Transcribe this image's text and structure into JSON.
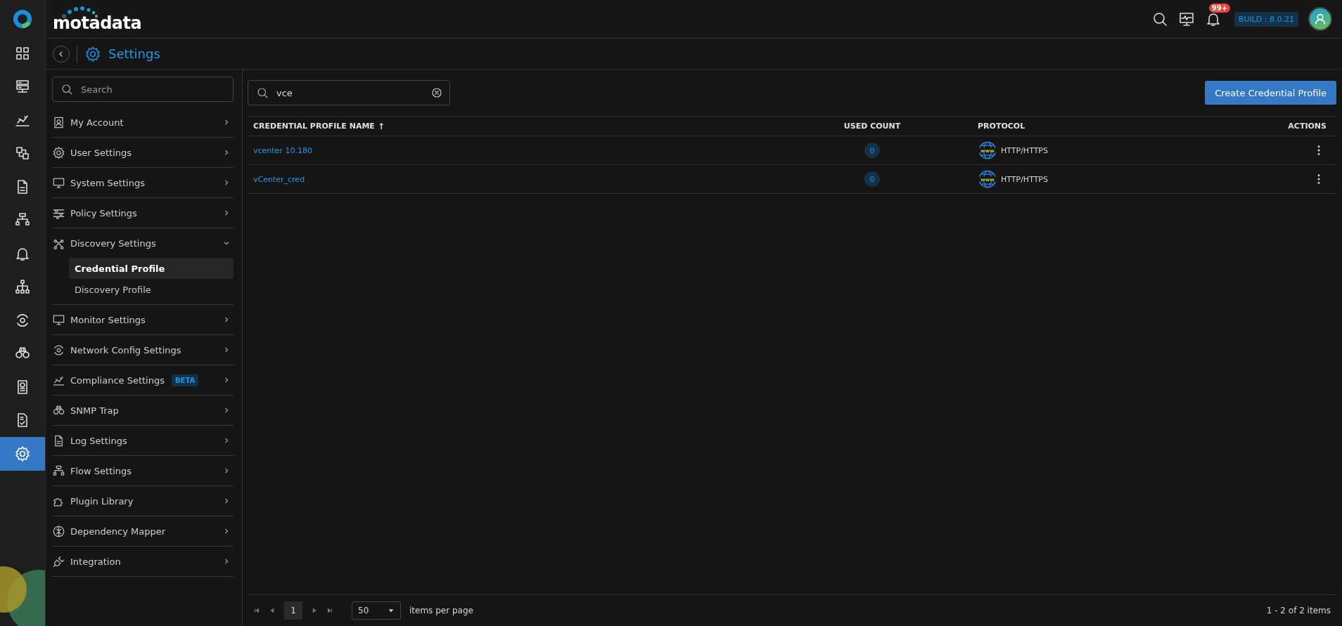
{
  "header": {
    "logo": "motadata",
    "notification_count": "99+",
    "build": "BUILD : 8.0.21"
  },
  "rail": [
    {
      "selected": false
    },
    {
      "selected": false
    },
    {
      "selected": false
    },
    {
      "selected": false
    },
    {
      "selected": false
    },
    {
      "selected": false
    },
    {
      "selected": false
    },
    {
      "selected": false
    },
    {
      "selected": false
    },
    {
      "selected": false
    },
    {
      "selected": false
    },
    {
      "selected": false
    },
    {
      "selected": true
    }
  ],
  "page_title": "Settings",
  "sidebar": {
    "search": {
      "placeholder": "Search"
    },
    "items": [
      {
        "label": "My Account",
        "expanded": false
      },
      {
        "label": "User Settings",
        "expanded": false
      },
      {
        "label": "System Settings",
        "expanded": false
      },
      {
        "label": "Policy Settings",
        "expanded": false
      },
      {
        "label": "Discovery Settings",
        "expanded": true,
        "children": [
          {
            "label": "Credential Profile",
            "selected": true
          },
          {
            "label": "Discovery Profile",
            "selected": false
          }
        ]
      },
      {
        "label": "Monitor Settings",
        "expanded": false
      },
      {
        "label": "Network Config Settings",
        "expanded": false
      },
      {
        "label": "Compliance Settings",
        "badge": "BETA",
        "expanded": false
      },
      {
        "label": "SNMP Trap",
        "expanded": false
      },
      {
        "label": "Log Settings",
        "expanded": false
      },
      {
        "label": "Flow Settings",
        "expanded": false
      },
      {
        "label": "Plugin Library",
        "expanded": false
      },
      {
        "label": "Dependency Mapper",
        "expanded": false
      },
      {
        "label": "Integration",
        "expanded": false
      }
    ]
  },
  "search": {
    "value": "vce"
  },
  "create_button": "Create Credential Profile",
  "table": {
    "columns": [
      {
        "label": "CREDENTIAL PROFILE NAME",
        "sort_indicator": "↑"
      },
      {
        "label": "USED COUNT"
      },
      {
        "label": "PROTOCOL"
      },
      {
        "label": "ACTIONS"
      }
    ],
    "rows": [
      {
        "name": "vcenter 10.180",
        "used_count": "0",
        "protocol_icon_text": "www",
        "protocol": "HTTP/HTTPS"
      },
      {
        "name": "vCenter_cred",
        "used_count": "0",
        "protocol_icon_text": "www",
        "protocol": "HTTP/HTTPS"
      }
    ]
  },
  "pagination": {
    "page": "1",
    "page_size": "50",
    "page_size_label": "items per page",
    "summary": "1 - 2 of 2 items"
  }
}
